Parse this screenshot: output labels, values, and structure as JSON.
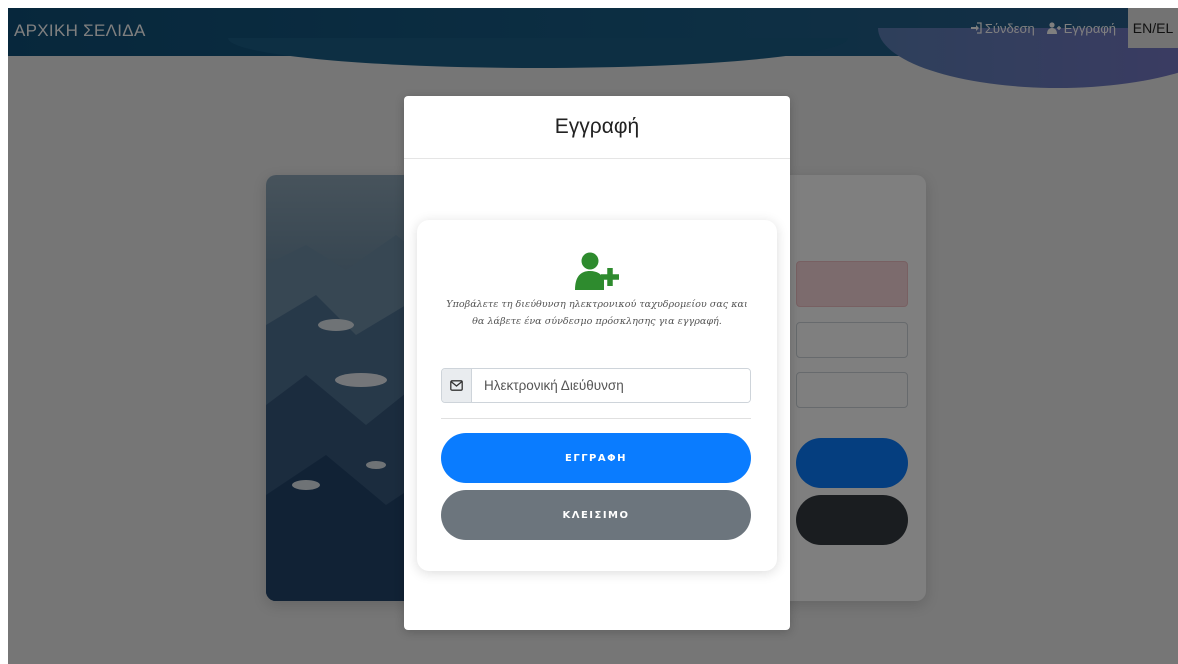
{
  "navbar": {
    "brand": "ΑΡΧΙΚΗ ΣΕΛΙΔΑ",
    "login_label": "Σύνδεση",
    "register_label": "Εγγραφή",
    "lang_label": "EN/EL"
  },
  "modal": {
    "title": "Εγγραφή",
    "icon": "user-plus-icon",
    "hint": "Υποβάλετε τη διεύθυνση ηλεκτρονικού ταχυδρομείου σας και θα λάβετε ένα σύνδεσμο πρόσκλησης για εγγραφή.",
    "email_placeholder": "Ηλεκτρονική Διεύθυνση",
    "email_value": "",
    "submit_label": "ΕΓΓΡΑΦΗ",
    "close_label": "ΚΛΕΙΣΙΜΟ"
  },
  "colors": {
    "navbar": "#1a5e87",
    "primary": "#0a7cff",
    "secondary": "#6c757d",
    "icon_green": "#2e8b2e"
  }
}
